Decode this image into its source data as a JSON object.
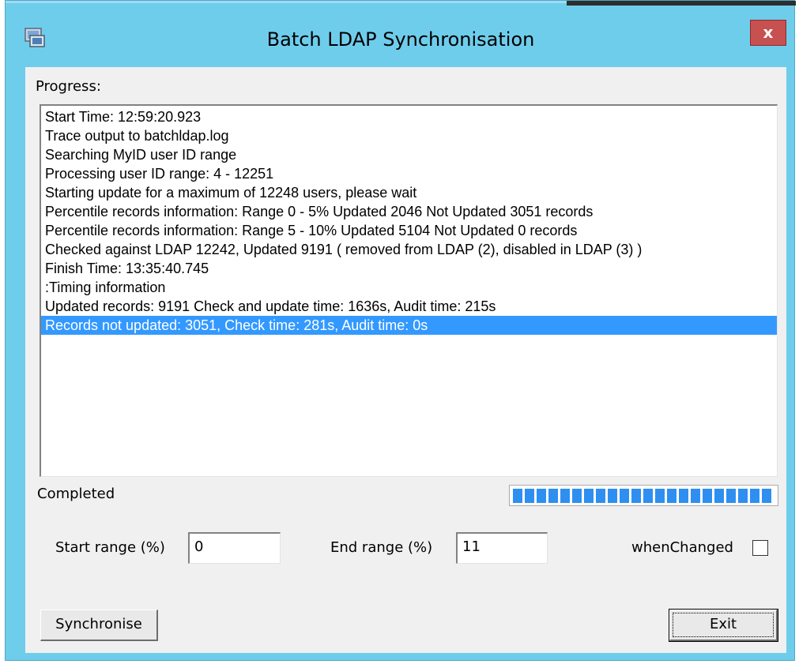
{
  "window": {
    "title": "Batch LDAP Synchronisation",
    "close_label": "x"
  },
  "progress_label": "Progress:",
  "log_lines": [
    "Start Time: 12:59:20.923",
    "Trace output to batchldap.log",
    "Searching MyID user ID range",
    "Processing user ID range: 4 - 12251",
    "Starting update for a maximum of 12248 users, please wait",
    "Percentile records information: Range 0 - 5% Updated 2046 Not Updated 3051 records",
    "Percentile records information: Range 5 - 10% Updated 5104 Not Updated 0 records",
    "Checked against LDAP 12242, Updated 9191 ( removed from LDAP (2), disabled in LDAP (3) )",
    "Finish Time: 13:35:40.745",
    " :Timing information",
    "Updated records: 9191 Check and update time: 1636s,  Audit time: 215s",
    "Records not updated: 3051, Check time: 281s,  Audit time: 0s"
  ],
  "selected_line_index": 11,
  "status": "Completed",
  "progress_bar": {
    "fraction": 1.0,
    "color": "#2f8ff0"
  },
  "form": {
    "start_range_label": "Start range (%)",
    "start_range_value": "0",
    "end_range_label": "End range (%)",
    "end_range_value": "11",
    "when_changed_label": "whenChanged",
    "when_changed_checked": false
  },
  "buttons": {
    "synchronise": "Synchronise",
    "exit": "Exit"
  },
  "colors": {
    "titlebar": "#6fcdec",
    "selection": "#3399ff",
    "close": "#c75050"
  }
}
